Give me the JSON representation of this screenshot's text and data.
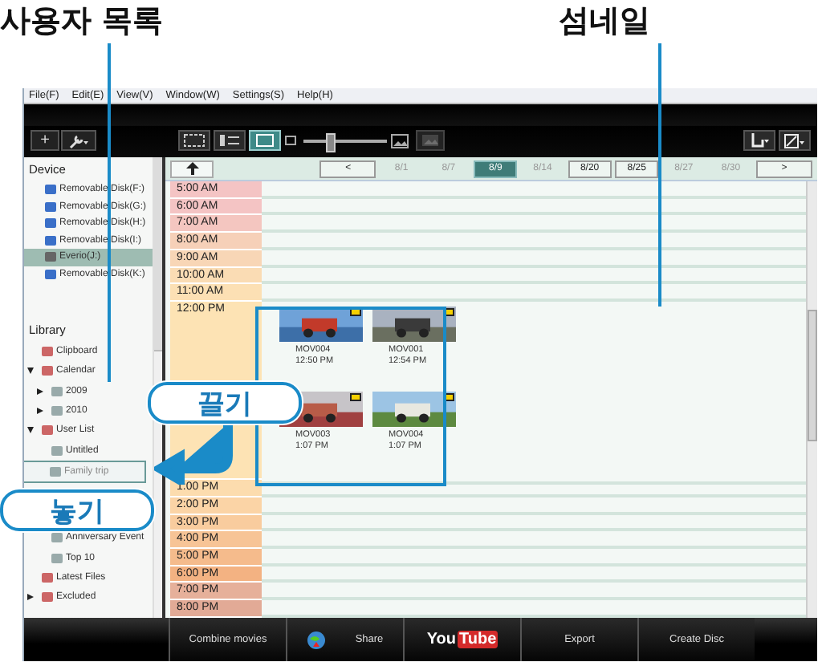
{
  "annotations": {
    "user_list_label": "사용자 목록",
    "thumbnail_label": "섬네일",
    "drag_label": "끌기",
    "drop_label": "놓기"
  },
  "menu": [
    "File(F)",
    "Edit(E)",
    "View(V)",
    "Window(W)",
    "Settings(S)",
    "Help(H)"
  ],
  "toolbar": {
    "add_label": "+",
    "view_modes": [
      {
        "selected": false
      },
      {
        "selected": false
      },
      {
        "selected": true
      }
    ],
    "zoom": {
      "level": 0.3
    }
  },
  "date_bar": {
    "prev": "<",
    "next": ">",
    "dates": [
      {
        "label": "8/1",
        "selected": false,
        "disabled": true
      },
      {
        "label": "8/7",
        "selected": false,
        "disabled": true
      },
      {
        "label": "8/9",
        "selected": true,
        "disabled": false
      },
      {
        "label": "8/14",
        "selected": false,
        "disabled": true
      },
      {
        "label": "8/20",
        "selected": false,
        "disabled": false
      },
      {
        "label": "8/25",
        "selected": false,
        "disabled": false
      },
      {
        "label": "8/27",
        "selected": false,
        "disabled": true
      },
      {
        "label": "8/30",
        "selected": false,
        "disabled": true
      }
    ]
  },
  "sidebar": {
    "device_heading": "Device",
    "devices": [
      {
        "label": "Removable Disk(F:)",
        "selected": false
      },
      {
        "label": "Removable Disk(G:)",
        "selected": false
      },
      {
        "label": "Removable Disk(H:)",
        "selected": false
      },
      {
        "label": "Removable Disk(I:)",
        "selected": false
      },
      {
        "label": "Everio(J:)",
        "selected": true
      },
      {
        "label": "Removable Disk(K:)",
        "selected": false
      }
    ],
    "library_heading": "Library",
    "library": [
      {
        "label": "Clipboard"
      },
      {
        "label": "Calendar",
        "expanded": true,
        "children": [
          {
            "label": "2009",
            "expanded": false
          },
          {
            "label": "2010",
            "expanded": false
          }
        ]
      },
      {
        "label": "User List",
        "expanded": true,
        "children": [
          {
            "label": "Untitled",
            "drop_target": false
          },
          {
            "label": "Family trip",
            "drop_target": true
          },
          {
            "label": "Anniversary Event",
            "drop_target": false
          },
          {
            "label": "Top 10",
            "drop_target": false
          }
        ]
      },
      {
        "label": "Latest Files"
      },
      {
        "label": "Excluded",
        "expanded": false
      }
    ]
  },
  "timeline": {
    "hours": [
      {
        "label": "5:00 AM",
        "color": "#f4c4c4"
      },
      {
        "label": "6:00 AM",
        "color": "#f4c4c4"
      },
      {
        "label": "7:00 AM",
        "color": "#f4c6c0"
      },
      {
        "label": "8:00 AM",
        "color": "#f6d0b8"
      },
      {
        "label": "9:00 AM",
        "color": "#f8d6b6"
      },
      {
        "label": "10:00 AM",
        "color": "#fadcb4"
      },
      {
        "label": "11:00 AM",
        "color": "#fce0b4"
      },
      {
        "label": "12:00 PM",
        "color": "#fde3b4",
        "thumbnails": [
          {
            "name": "MOV004",
            "time": "12:50 PM",
            "flag": true
          },
          {
            "name": "MOV001",
            "time": "12:54 PM",
            "flag": true
          },
          {
            "name": "MOV003",
            "time": "1:07 PM",
            "flag": true
          },
          {
            "name": "MOV004",
            "time": "1:07 PM",
            "flag": true
          }
        ]
      },
      {
        "label": "1:00 PM",
        "color": "#fcdcae"
      },
      {
        "label": "2:00 PM",
        "color": "#fbd4a6"
      },
      {
        "label": "3:00 PM",
        "color": "#f9cc9e"
      },
      {
        "label": "4:00 PM",
        "color": "#f7c496"
      },
      {
        "label": "5:00 PM",
        "color": "#f5bb8c"
      },
      {
        "label": "6:00 PM",
        "color": "#f3b282"
      },
      {
        "label": "7:00 PM",
        "color": "#e6b09a"
      },
      {
        "label": "8:00 PM",
        "color": "#e2aa96"
      }
    ]
  },
  "bottom_bar": [
    {
      "kind": "text",
      "label": "Combine movies"
    },
    {
      "kind": "share",
      "label": "Share"
    },
    {
      "kind": "youtube",
      "label": "You",
      "label2": "Tube"
    },
    {
      "kind": "text",
      "label": "Export"
    },
    {
      "kind": "text",
      "label": "Create Disc"
    }
  ]
}
